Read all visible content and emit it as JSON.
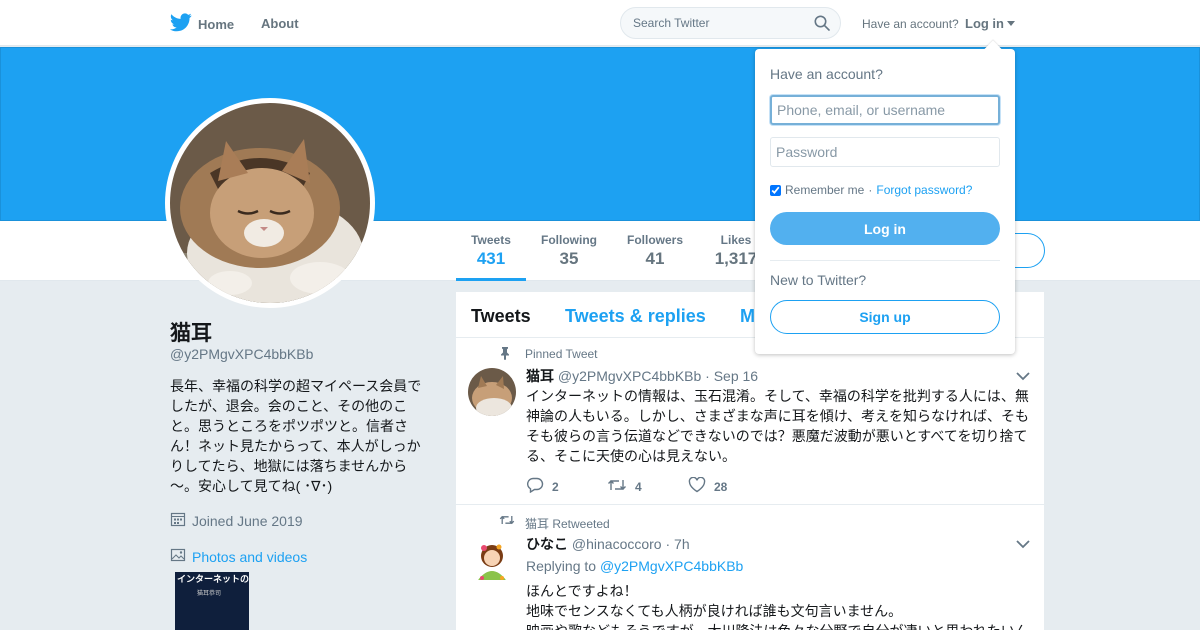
{
  "topbar": {
    "home_label": "Home",
    "about_label": "About",
    "search_placeholder": "Search Twitter",
    "have_account": "Have an account?",
    "login_label": "Log in"
  },
  "profile": {
    "name": "猫耳",
    "handle": "@y2PMgvXPC4bbKBb",
    "bio": "長年、幸福の科学の超マイペース会員でしたが、退会。会のこと、その他のこと。思うところをポツポツと。信者さん！ネット見たからって、本人がしっかりしてたら、地獄には落ちませんから～。安心して見てね( ･∇･)",
    "joined": "Joined June 2019",
    "photos_label": "Photos and videos",
    "thumb_text": "インターネットの情報は",
    "thumb_sub": "猫耳恭司"
  },
  "stats": [
    {
      "label": "Tweets",
      "value": "431"
    },
    {
      "label": "Following",
      "value": "35"
    },
    {
      "label": "Followers",
      "value": "41"
    },
    {
      "label": "Likes",
      "value": "1,317"
    }
  ],
  "timeline": {
    "tabs": [
      "Tweets",
      "Tweets & replies",
      "M"
    ],
    "tweets": [
      {
        "context": "Pinned Tweet",
        "name": "猫耳",
        "handle": "@y2PMgvXPC4bbKBb",
        "time": "· Sep 16",
        "text": "インターネットの情報は、玉石混淆。そして、幸福の科学を批判する人には、無神論の人もいる。しかし、さまざまな声に耳を傾け、考えを知らなければ、そもそも彼らの言う伝道などできないのでは？悪魔だ波動が悪いとすべてを切り捨てる、そこに天使の心は見えない。",
        "replies": "2",
        "retweets": "4",
        "likes": "28"
      },
      {
        "context": "猫耳 Retweeted",
        "name": "ひなこ",
        "handle": "@hinacoccoro",
        "time": "· 7h",
        "replying_prefix": "Replying to",
        "replying_handle": "@y2PMgvXPC4bbKBb",
        "line1": "ほんとですよね！",
        "line2": "地味でセンスなくても人柄が良ければ誰も文句言いません。",
        "line3": "映画や歌などもそうですが、大川隆法は色々な分野で自分が凄いと思われたいん"
      }
    ]
  },
  "login_dropdown": {
    "question": "Have an account?",
    "username_placeholder": "Phone, email, or username",
    "password_placeholder": "Password",
    "remember": "Remember me",
    "separator": "·",
    "forgot": "Forgot password?",
    "login_button": "Log in",
    "new_question": "New to Twitter?",
    "signup_button": "Sign up"
  },
  "colors": {
    "brand": "#1da1f2",
    "banner": "#1da1f2",
    "background": "#e6ecf0"
  },
  "icons": [
    "twitter-bird-icon",
    "search-icon",
    "pin-icon",
    "retweet-icon",
    "reply-icon",
    "like-icon",
    "calendar-icon",
    "photo-icon",
    "chevron-down-icon"
  ]
}
